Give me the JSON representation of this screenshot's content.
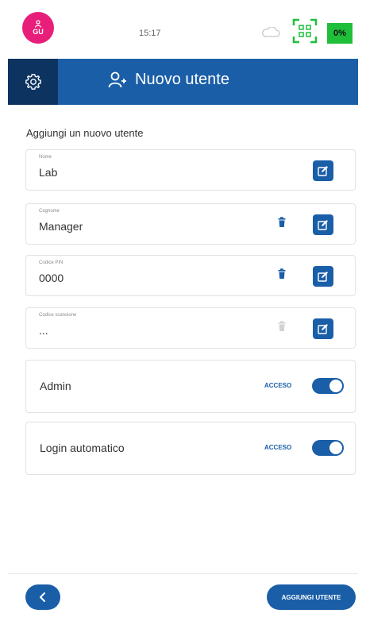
{
  "status_bar": {
    "avatar_initials": "GU",
    "time": "15:17",
    "battery": "0%"
  },
  "header": {
    "title": "Nuovo utente"
  },
  "section_title": "Aggiungi un nuovo utente",
  "fields": [
    {
      "label": "Nome",
      "value": "Lab"
    },
    {
      "label": "Cognome",
      "value": "Manager"
    },
    {
      "label": "Codice PIN",
      "value": "0000"
    },
    {
      "label": "Codice scansione",
      "value": "..."
    }
  ],
  "toggles": [
    {
      "label": "Admin",
      "state": "ACCESO"
    },
    {
      "label": "Login automatico",
      "state": "ACCESO"
    }
  ],
  "footer": {
    "add_button": "AGGIUNGI UTENTE"
  },
  "colors": {
    "primary": "#1a5ea8",
    "header_dark": "#0d3460",
    "avatar": "#e81f7a",
    "battery": "#1fbf3a"
  }
}
